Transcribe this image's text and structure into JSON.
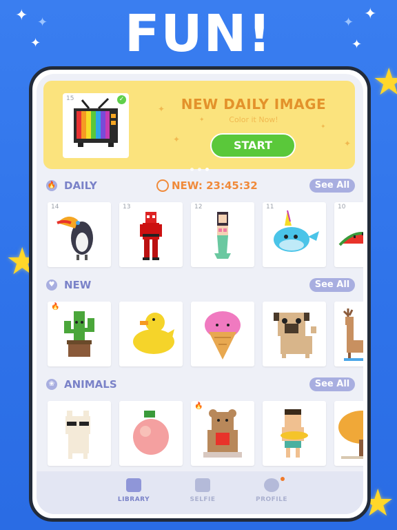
{
  "headline": "FUN!",
  "banner": {
    "thumb_num": "15",
    "title": "NEW DAILY IMAGE",
    "subtitle": "Color it Now!",
    "start_label": "START"
  },
  "sections": {
    "daily": {
      "label": "DAILY",
      "timer": "NEW: 23:45:32",
      "see_all": "See All",
      "cards": [
        {
          "num": "14",
          "subject": "toucan"
        },
        {
          "num": "13",
          "subject": "deadpool"
        },
        {
          "num": "12",
          "subject": "mermaid"
        },
        {
          "num": "11",
          "subject": "narwhal"
        },
        {
          "num": "10",
          "subject": "watermelon"
        }
      ]
    },
    "new": {
      "label": "NEW",
      "see_all": "See All",
      "cards": [
        {
          "subject": "cactus"
        },
        {
          "subject": "duck"
        },
        {
          "subject": "ice-cream"
        },
        {
          "subject": "pug"
        },
        {
          "subject": "deer"
        }
      ]
    },
    "animals": {
      "label": "ANIMALS",
      "see_all": "See All",
      "cards": [
        {
          "subject": "llama"
        },
        {
          "subject": "peach"
        },
        {
          "subject": "teddy-bear"
        },
        {
          "subject": "boy"
        },
        {
          "subject": "tree"
        }
      ]
    }
  },
  "nav": {
    "library": "LIBRARY",
    "selfie": "SELFIE",
    "profile": "PROFILE"
  },
  "colors": {
    "background": "#2f73ea",
    "banner": "#fbe37d",
    "title_orange": "#e3922b",
    "start_green": "#5ac83a",
    "accent_lavender": "#a8aee0",
    "timer_orange": "#f08a3a"
  }
}
